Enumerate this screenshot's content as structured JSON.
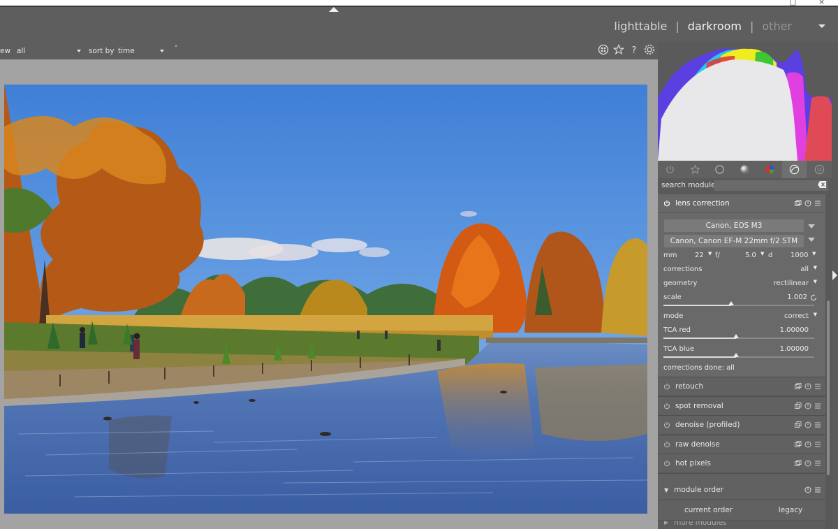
{
  "header": {
    "views": {
      "lighttable": "lighttable",
      "darkroom": "darkroom",
      "other": "other",
      "sep": "|"
    }
  },
  "filterbar": {
    "view_label": "ew",
    "view_value": "all",
    "sort_label": "sort by",
    "sort_value": "time"
  },
  "right_panel": {
    "groups": [
      "power-icon",
      "star-icon",
      "circle-icon",
      "sphere-icon",
      "color-icon",
      "correct-icon",
      "effect-icon"
    ],
    "search_label": "search module",
    "lens": {
      "title": "lens correction",
      "camera": "Canon, EOS M3",
      "lens": "Canon, Canon EF-M 22mm f/2 STM",
      "mm_label": "mm",
      "mm_value": "22",
      "f_label": "f/",
      "f_value": "5.0",
      "d_label": "d",
      "d_value": "1000",
      "corrections_label": "corrections",
      "corrections_value": "all",
      "geometry_label": "geometry",
      "geometry_value": "rectilinear",
      "scale_label": "scale",
      "scale_value": "1.002",
      "scale_fill": 0.45,
      "mode_label": "mode",
      "mode_value": "correct",
      "tca_red_label": "TCA red",
      "tca_red_value": "1.00000",
      "tca_red_fill": 0.48,
      "tca_blue_label": "TCA blue",
      "tca_blue_value": "1.00000",
      "tca_blue_fill": 0.48,
      "done": "corrections done: all"
    },
    "modules": [
      "retouch",
      "spot removal",
      "denoise (profiled)",
      "raw denoise",
      "hot pixels"
    ],
    "module_order": {
      "title": "module order",
      "current": "current order",
      "legacy": "legacy"
    },
    "more_modules": "more modules"
  }
}
